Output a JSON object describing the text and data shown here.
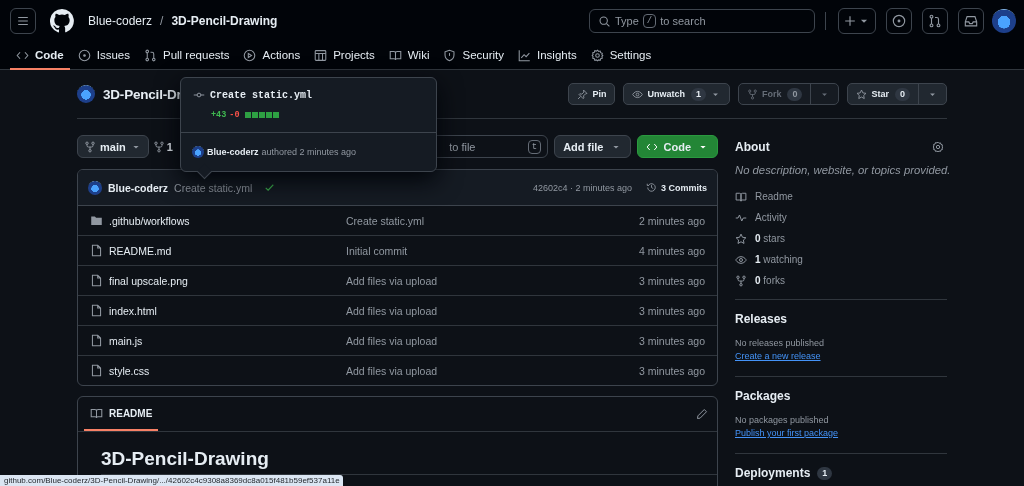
{
  "header": {
    "owner": "Blue-coderz",
    "separator": "/",
    "repo": "3D-Pencil-Drawing",
    "search": {
      "placeholder": "Type",
      "key": "/",
      "placeholder_end": "to search"
    }
  },
  "tabs": [
    {
      "kind": "code",
      "label": "Code",
      "selected": true
    },
    {
      "kind": "issues",
      "label": "Issues",
      "selected": false
    },
    {
      "kind": "pulls",
      "label": "Pull requests",
      "selected": false
    },
    {
      "kind": "actions",
      "label": "Actions",
      "selected": false
    },
    {
      "kind": "projects",
      "label": "Projects",
      "selected": false
    },
    {
      "kind": "wiki",
      "label": "Wiki",
      "selected": false
    },
    {
      "kind": "security",
      "label": "Security",
      "selected": false
    },
    {
      "kind": "insights",
      "label": "Insights",
      "selected": false
    },
    {
      "kind": "settings",
      "label": "Settings",
      "selected": false
    }
  ],
  "repo": {
    "title": "3D-Pencil-Dr",
    "actions": [
      {
        "kind": "pin",
        "label": "Pin",
        "disabled": false
      },
      {
        "kind": "watch",
        "label": "Unwatch",
        "count": "1",
        "disabled": false
      },
      {
        "kind": "fork",
        "label": "Fork",
        "count": "0",
        "disabled": true
      },
      {
        "kind": "star",
        "label": "Star",
        "count": "0",
        "disabled": false
      }
    ]
  },
  "toolbar": {
    "branch": "main",
    "branch_count": "1",
    "file_search": {
      "placeholder": "to file",
      "key": "t"
    },
    "add_file": "Add file",
    "code": "Code"
  },
  "latest_commit": {
    "author": "Blue-coderz",
    "message": "Create static.yml",
    "checks_passed": true,
    "hash_time": "42602c4 · 2 minutes ago",
    "commits": "3 Commits"
  },
  "files": [
    {
      "kind": "folder",
      "name": ".github/workflows",
      "message": "Create static.yml",
      "time": "2 minutes ago"
    },
    {
      "kind": "file",
      "name": "README.md",
      "message": "Initial commit",
      "time": "4 minutes ago"
    },
    {
      "kind": "file",
      "name": "final upscale.png",
      "message": "Add files via upload",
      "time": "3 minutes ago"
    },
    {
      "kind": "file",
      "name": "index.html",
      "message": "Add files via upload",
      "time": "3 minutes ago"
    },
    {
      "kind": "file",
      "name": "main.js",
      "message": "Add files via upload",
      "time": "3 minutes ago"
    },
    {
      "kind": "file",
      "name": "style.css",
      "message": "Add files via upload",
      "time": "3 minutes ago"
    }
  ],
  "readme": {
    "tab": "README",
    "heading": "3D-Pencil-Drawing"
  },
  "popover": {
    "message": "Create static.yml",
    "additions": "+43",
    "deletions": "-0",
    "blocks": [
      {
        "added": true
      },
      {
        "added": true
      },
      {
        "added": true
      },
      {
        "added": true
      },
      {
        "added": true
      }
    ],
    "author": "Blue-coderz",
    "authored": "authored 2 minutes ago"
  },
  "about": {
    "title": "About",
    "description": "No description, website, or topics provided.",
    "items": [
      {
        "kind": "book",
        "text": "Readme"
      },
      {
        "kind": "pulse",
        "text": "Activity"
      },
      {
        "kind": "star",
        "text": "**0** stars"
      },
      {
        "kind": "eye",
        "text": "**1** watching"
      },
      {
        "kind": "fork",
        "text": "**0** forks"
      }
    ]
  },
  "sections": [
    {
      "title": "Releases",
      "note": "No releases published",
      "link": "Create a new release"
    },
    {
      "title": "Packages",
      "note": "No packages published",
      "link": "Publish your first package"
    },
    {
      "title": "Deployments",
      "count": "1"
    }
  ],
  "status_bar": {
    "url": "github.com/Blue-coderz/3D-Pencil-Drawing/.../42602c4c9308a8369dc8a015f481b59ef537a11e"
  }
}
